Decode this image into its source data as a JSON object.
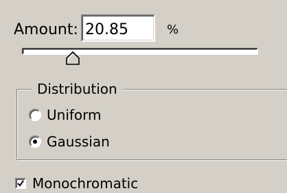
{
  "amount": {
    "label": "Amount:",
    "value": "20.85",
    "unit": "%"
  },
  "slider": {
    "value_percent": 20.85,
    "min": 0,
    "max": 100
  },
  "distribution": {
    "title": "Distribution",
    "options": [
      {
        "label": "Uniform",
        "selected": false
      },
      {
        "label": "Gaussian",
        "selected": true
      }
    ]
  },
  "monochromatic": {
    "label": "Monochromatic",
    "checked": true
  },
  "colors": {
    "panel_background": "#d4d0c8",
    "field_background": "#ffffff",
    "text": "#000000"
  }
}
